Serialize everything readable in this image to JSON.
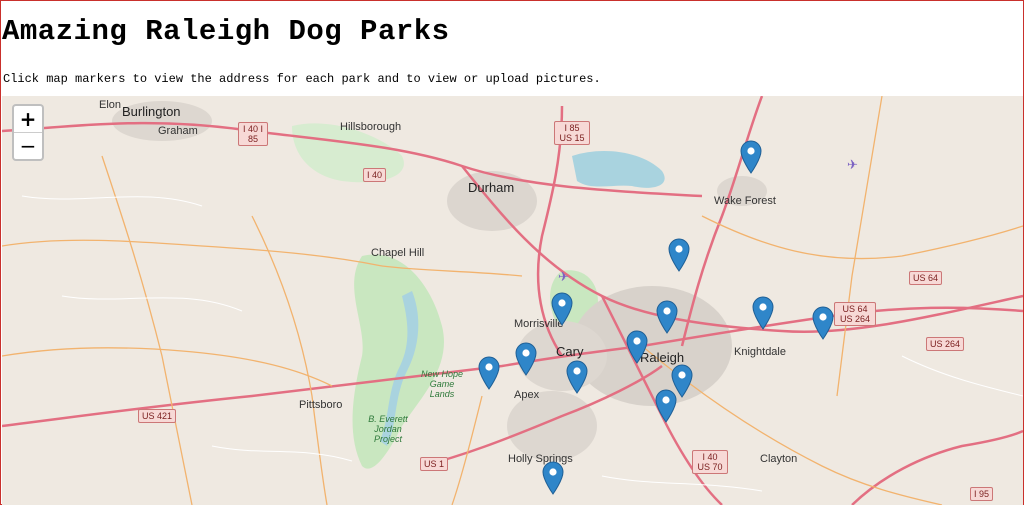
{
  "page": {
    "title": "Amazing Raleigh Dog Parks",
    "instructions": "Click map markers to view the address for each park and to view or upload pictures."
  },
  "map": {
    "zoom_in": "+",
    "zoom_out": "−",
    "marker_color": "#2f86c9",
    "places": [
      {
        "name": "Elon",
        "kind": "town"
      },
      {
        "name": "Burlington",
        "kind": "big"
      },
      {
        "name": "Graham",
        "kind": "town"
      },
      {
        "name": "Hillsborough",
        "kind": "town"
      },
      {
        "name": "Durham",
        "kind": "big"
      },
      {
        "name": "Wake Forest",
        "kind": "town"
      },
      {
        "name": "Chapel Hill",
        "kind": "town"
      },
      {
        "name": "Morrisville",
        "kind": "town"
      },
      {
        "name": "Cary",
        "kind": "big"
      },
      {
        "name": "Raleigh",
        "kind": "big"
      },
      {
        "name": "Knightdale",
        "kind": "town"
      },
      {
        "name": "Apex",
        "kind": "town"
      },
      {
        "name": "Pittsboro",
        "kind": "town"
      },
      {
        "name": "Holly Springs",
        "kind": "town"
      },
      {
        "name": "Clayton",
        "kind": "town"
      },
      {
        "name": "New Hope Game Lands",
        "kind": "park"
      },
      {
        "name": "B. Everett Jordan Project",
        "kind": "park"
      }
    ],
    "shields": [
      "I 40 I 85",
      "I 85 US 15",
      "I 40",
      "US 64",
      "US 64 US 264",
      "US 264",
      "US 421",
      "US 1",
      "I 40 US 70",
      "I 95"
    ],
    "marker_count": 15
  }
}
